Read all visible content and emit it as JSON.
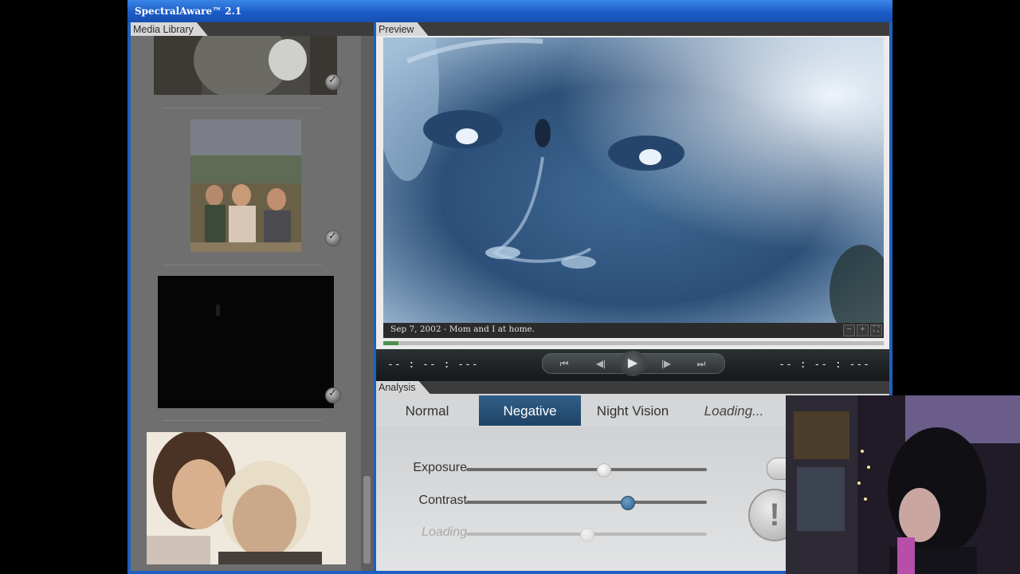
{
  "app": {
    "title": "SpectralAware™ 2.1"
  },
  "media_library": {
    "label": "Media Library",
    "items": [
      {
        "name": "partial-photo",
        "checked": true
      },
      {
        "name": "family-outdoor-photo",
        "checked": true
      },
      {
        "name": "dark-photo",
        "checked": true
      },
      {
        "name": "women-portrait-photo",
        "checked": false
      }
    ]
  },
  "preview": {
    "label": "Preview",
    "caption": "Sep 7, 2002 - Mom and I at home.",
    "zoom": {
      "minus": "−",
      "plus": "+",
      "fullscreen": "⛶"
    },
    "time_left": "-- : -- : ---",
    "time_right": "-- : -- : ---",
    "progress": 0.03,
    "controls": {
      "skip_back": "⏮",
      "step_back": "◀|",
      "play": "▶",
      "step_forward": "|▶",
      "skip_forward": "⏭"
    }
  },
  "analysis": {
    "label": "Analysis",
    "tabs": [
      {
        "label": "Normal",
        "active": false
      },
      {
        "label": "Negative",
        "active": true
      },
      {
        "label": "Night Vision",
        "active": false
      },
      {
        "label": "Loading...",
        "active": false
      }
    ],
    "sliders": [
      {
        "label": "Exposure",
        "value": 0.57
      },
      {
        "label": "Contrast",
        "value": 0.67
      },
      {
        "label": "Loading",
        "value": 0.5,
        "disabled": true
      }
    ],
    "alert_button": "!"
  },
  "colors": {
    "title_blue": "#1e5fbf",
    "active_tab": "#1d4366",
    "negative_tint": "#6a8fb8"
  }
}
